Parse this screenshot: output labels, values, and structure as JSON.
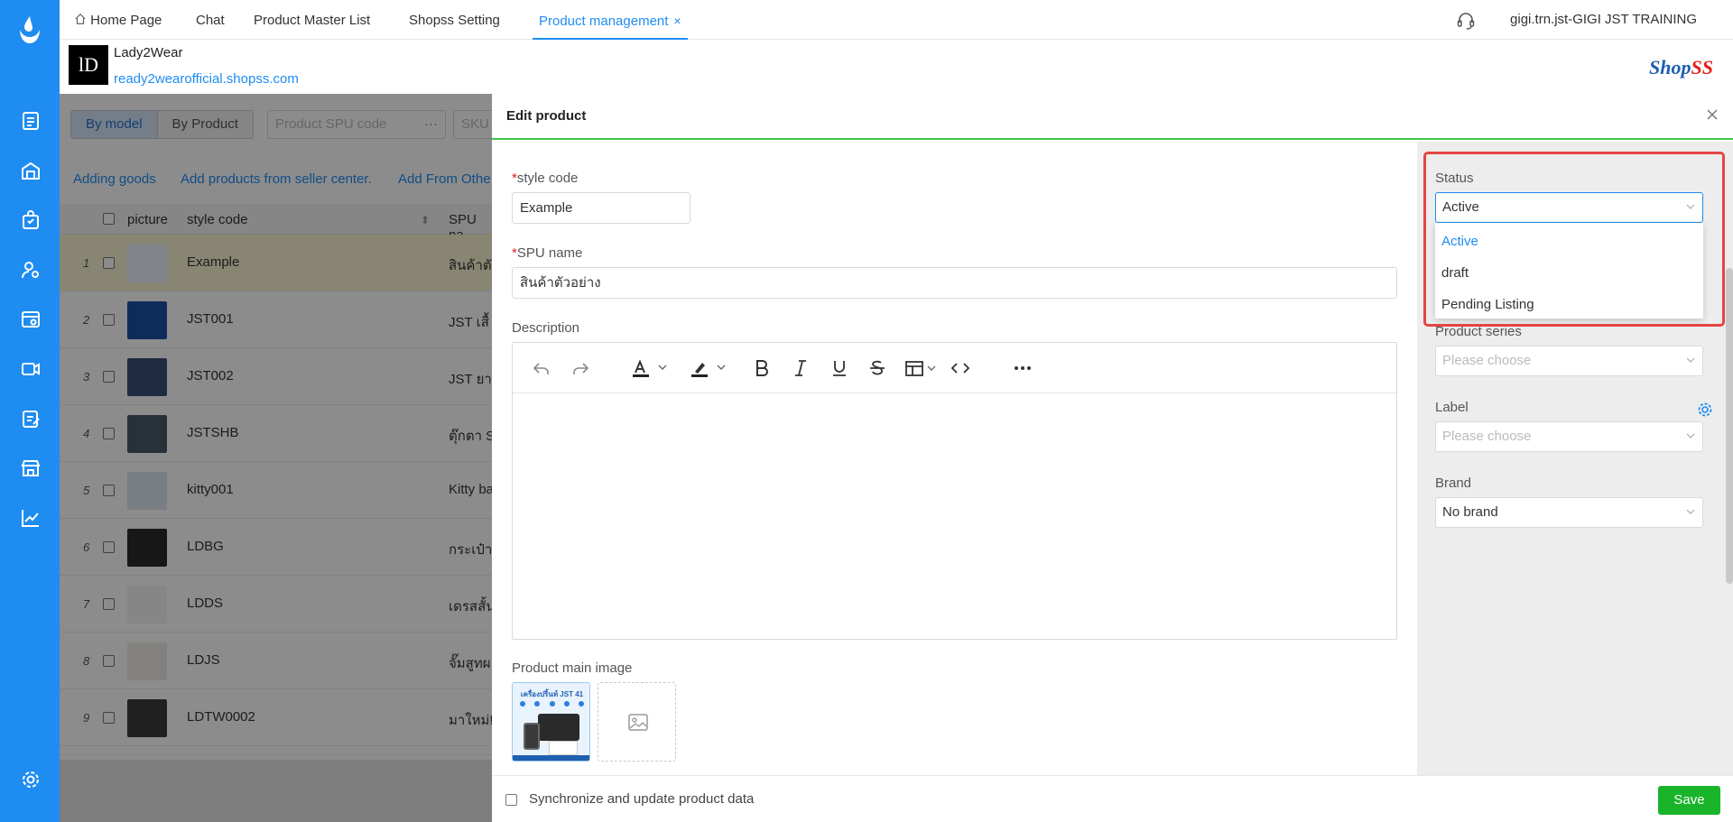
{
  "top_tabs": [
    "Home Page",
    "Chat",
    "Product Master List",
    "Shopss Setting",
    "Product management"
  ],
  "close_glyph": "×",
  "user": "gigi.trn.jst-GIGI JST TRAINING",
  "store": {
    "logo_text": "lD",
    "name": "Lady2Wear",
    "url": "ready2wearofficial.shopss.com"
  },
  "brand_logo": {
    "first": "Shop",
    "second": "SS"
  },
  "list": {
    "view_tabs": [
      "By model",
      "By Product"
    ],
    "spu_placeholder": "Product SPU code",
    "spu_more": "···",
    "sku_placeholder": "SKU",
    "links": [
      "Adding goods",
      "Add products from seller center.",
      "Add From Othe"
    ],
    "headers": {
      "picture": "picture",
      "style_code": "style code",
      "spu": "SPU na"
    },
    "sort_glyph": "⬍",
    "rows": [
      {
        "num": "1",
        "code": "Example",
        "spu": "สินค้าตั"
      },
      {
        "num": "2",
        "code": "JST001",
        "spu": "JST เสื้"
      },
      {
        "num": "3",
        "code": "JST002",
        "spu": "JST ยา"
      },
      {
        "num": "4",
        "code": "JSTSHB",
        "spu": "ตุ๊กตา S"
      },
      {
        "num": "5",
        "code": "kitty001",
        "spu": "Kitty ba"
      },
      {
        "num": "6",
        "code": "LDBG",
        "spu": "กระเป๋า"
      },
      {
        "num": "7",
        "code": "LDDS",
        "spu": "เดรสสั้น"
      },
      {
        "num": "8",
        "code": "LDJS",
        "spu": "จั๊มสูทผ"
      },
      {
        "num": "9",
        "code": "LDTW0002",
        "spu": "มาใหม่!"
      }
    ]
  },
  "drawer": {
    "title": "Edit product",
    "required_mark": "*",
    "style_code_label": "style code",
    "style_code_value": "Example",
    "spu_name_label": "SPU name",
    "spu_name_value": "สินค้าตัวอย่าง",
    "description_label": "Description",
    "main_image_label": "Product main image",
    "thumb_text": "เครื่องปริ้นท์ JST 41",
    "sync_label": "Synchronize and update product data",
    "save_label": "Save"
  },
  "side": {
    "status_label": "Status",
    "status_value": "Active",
    "status_options": [
      "Active",
      "draft",
      "Pending Listing"
    ],
    "series_label": "Product series",
    "series_placeholder": "Please choose",
    "label_label": "Label",
    "label_placeholder": "Please choose",
    "brand_label": "Brand",
    "brand_value": "No brand"
  },
  "colors": {
    "primary": "#1f8cf2",
    "save": "#19b42a",
    "highlight": "#e54545",
    "selected_row": "#f7f4d2"
  },
  "icons": [
    "app-logo-icon",
    "document-icon",
    "warehouse-icon",
    "bag-icon",
    "users-gear-icon",
    "store-settings-icon",
    "video-icon",
    "edit-list-icon",
    "shop-icon",
    "chart-icon",
    "settings-icon",
    "home-icon",
    "headset-icon",
    "close-icon",
    "undo-icon",
    "redo-icon",
    "font-color-icon",
    "highlight-icon",
    "bold-icon",
    "italic-icon",
    "underline-icon",
    "strikethrough-icon",
    "table-icon",
    "code-icon",
    "more-icon",
    "image-placeholder-icon",
    "gear-icon",
    "chevron-down-icon"
  ]
}
